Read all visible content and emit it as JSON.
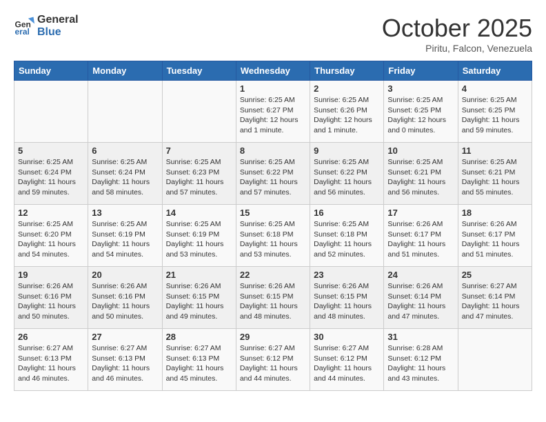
{
  "header": {
    "logo_general": "General",
    "logo_blue": "Blue",
    "title": "October 2025",
    "location": "Piritu, Falcon, Venezuela"
  },
  "days_of_week": [
    "Sunday",
    "Monday",
    "Tuesday",
    "Wednesday",
    "Thursday",
    "Friday",
    "Saturday"
  ],
  "weeks": [
    [
      {
        "day": null,
        "info": null
      },
      {
        "day": null,
        "info": null
      },
      {
        "day": null,
        "info": null
      },
      {
        "day": "1",
        "info": "Sunrise: 6:25 AM\nSunset: 6:27 PM\nDaylight: 12 hours\nand 1 minute."
      },
      {
        "day": "2",
        "info": "Sunrise: 6:25 AM\nSunset: 6:26 PM\nDaylight: 12 hours\nand 1 minute."
      },
      {
        "day": "3",
        "info": "Sunrise: 6:25 AM\nSunset: 6:25 PM\nDaylight: 12 hours\nand 0 minutes."
      },
      {
        "day": "4",
        "info": "Sunrise: 6:25 AM\nSunset: 6:25 PM\nDaylight: 11 hours\nand 59 minutes."
      }
    ],
    [
      {
        "day": "5",
        "info": "Sunrise: 6:25 AM\nSunset: 6:24 PM\nDaylight: 11 hours\nand 59 minutes."
      },
      {
        "day": "6",
        "info": "Sunrise: 6:25 AM\nSunset: 6:24 PM\nDaylight: 11 hours\nand 58 minutes."
      },
      {
        "day": "7",
        "info": "Sunrise: 6:25 AM\nSunset: 6:23 PM\nDaylight: 11 hours\nand 57 minutes."
      },
      {
        "day": "8",
        "info": "Sunrise: 6:25 AM\nSunset: 6:22 PM\nDaylight: 11 hours\nand 57 minutes."
      },
      {
        "day": "9",
        "info": "Sunrise: 6:25 AM\nSunset: 6:22 PM\nDaylight: 11 hours\nand 56 minutes."
      },
      {
        "day": "10",
        "info": "Sunrise: 6:25 AM\nSunset: 6:21 PM\nDaylight: 11 hours\nand 56 minutes."
      },
      {
        "day": "11",
        "info": "Sunrise: 6:25 AM\nSunset: 6:21 PM\nDaylight: 11 hours\nand 55 minutes."
      }
    ],
    [
      {
        "day": "12",
        "info": "Sunrise: 6:25 AM\nSunset: 6:20 PM\nDaylight: 11 hours\nand 54 minutes."
      },
      {
        "day": "13",
        "info": "Sunrise: 6:25 AM\nSunset: 6:19 PM\nDaylight: 11 hours\nand 54 minutes."
      },
      {
        "day": "14",
        "info": "Sunrise: 6:25 AM\nSunset: 6:19 PM\nDaylight: 11 hours\nand 53 minutes."
      },
      {
        "day": "15",
        "info": "Sunrise: 6:25 AM\nSunset: 6:18 PM\nDaylight: 11 hours\nand 53 minutes."
      },
      {
        "day": "16",
        "info": "Sunrise: 6:25 AM\nSunset: 6:18 PM\nDaylight: 11 hours\nand 52 minutes."
      },
      {
        "day": "17",
        "info": "Sunrise: 6:26 AM\nSunset: 6:17 PM\nDaylight: 11 hours\nand 51 minutes."
      },
      {
        "day": "18",
        "info": "Sunrise: 6:26 AM\nSunset: 6:17 PM\nDaylight: 11 hours\nand 51 minutes."
      }
    ],
    [
      {
        "day": "19",
        "info": "Sunrise: 6:26 AM\nSunset: 6:16 PM\nDaylight: 11 hours\nand 50 minutes."
      },
      {
        "day": "20",
        "info": "Sunrise: 6:26 AM\nSunset: 6:16 PM\nDaylight: 11 hours\nand 50 minutes."
      },
      {
        "day": "21",
        "info": "Sunrise: 6:26 AM\nSunset: 6:15 PM\nDaylight: 11 hours\nand 49 minutes."
      },
      {
        "day": "22",
        "info": "Sunrise: 6:26 AM\nSunset: 6:15 PM\nDaylight: 11 hours\nand 48 minutes."
      },
      {
        "day": "23",
        "info": "Sunrise: 6:26 AM\nSunset: 6:15 PM\nDaylight: 11 hours\nand 48 minutes."
      },
      {
        "day": "24",
        "info": "Sunrise: 6:26 AM\nSunset: 6:14 PM\nDaylight: 11 hours\nand 47 minutes."
      },
      {
        "day": "25",
        "info": "Sunrise: 6:27 AM\nSunset: 6:14 PM\nDaylight: 11 hours\nand 47 minutes."
      }
    ],
    [
      {
        "day": "26",
        "info": "Sunrise: 6:27 AM\nSunset: 6:13 PM\nDaylight: 11 hours\nand 46 minutes."
      },
      {
        "day": "27",
        "info": "Sunrise: 6:27 AM\nSunset: 6:13 PM\nDaylight: 11 hours\nand 46 minutes."
      },
      {
        "day": "28",
        "info": "Sunrise: 6:27 AM\nSunset: 6:13 PM\nDaylight: 11 hours\nand 45 minutes."
      },
      {
        "day": "29",
        "info": "Sunrise: 6:27 AM\nSunset: 6:12 PM\nDaylight: 11 hours\nand 44 minutes."
      },
      {
        "day": "30",
        "info": "Sunrise: 6:27 AM\nSunset: 6:12 PM\nDaylight: 11 hours\nand 44 minutes."
      },
      {
        "day": "31",
        "info": "Sunrise: 6:28 AM\nSunset: 6:12 PM\nDaylight: 11 hours\nand 43 minutes."
      },
      {
        "day": null,
        "info": null
      }
    ]
  ]
}
